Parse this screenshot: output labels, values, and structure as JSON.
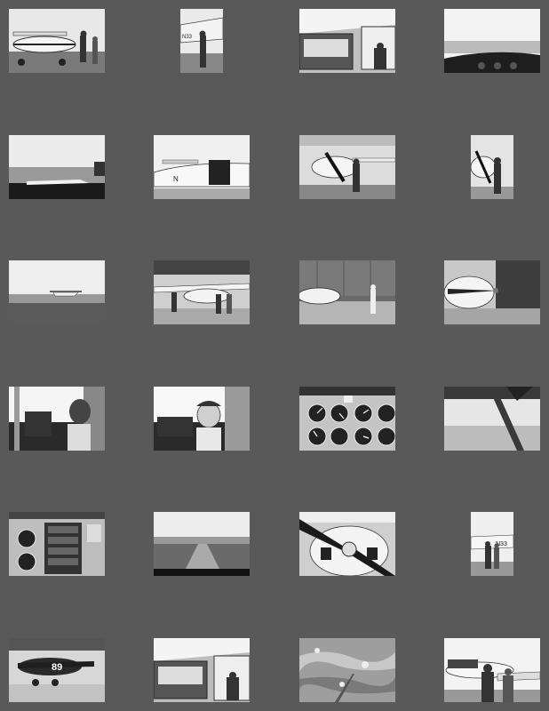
{
  "background_color": "#595959",
  "gallery": {
    "rows": [
      {
        "items": [
          {
            "subject": "plane-and-people-on-tarmac",
            "orientation": "landscape"
          },
          {
            "subject": "person-by-plane-tail",
            "orientation": "portrait"
          },
          {
            "subject": "person-at-cockpit-door",
            "orientation": "landscape"
          },
          {
            "subject": "instrument-panel-view-out",
            "orientation": "landscape"
          }
        ]
      },
      {
        "items": [
          {
            "subject": "wing-in-flight-over-water",
            "orientation": "landscape"
          },
          {
            "subject": "plane-side-door-open",
            "orientation": "landscape"
          },
          {
            "subject": "person-by-propeller-at-hangar",
            "orientation": "landscape"
          },
          {
            "subject": "person-at-nose-of-plane",
            "orientation": "portrait"
          }
        ]
      },
      {
        "items": [
          {
            "subject": "plane-on-runway-distance",
            "orientation": "landscape"
          },
          {
            "subject": "people-by-plane-at-hangar",
            "orientation": "landscape"
          },
          {
            "subject": "plane-nose-in-hangar",
            "orientation": "landscape"
          },
          {
            "subject": "propeller-closeup-hangar",
            "orientation": "landscape"
          }
        ]
      },
      {
        "items": [
          {
            "subject": "pilot-in-cockpit",
            "orientation": "landscape"
          },
          {
            "subject": "boy-in-cockpit-seat",
            "orientation": "landscape"
          },
          {
            "subject": "instrument-gauges-panel",
            "orientation": "landscape"
          },
          {
            "subject": "wing-strut-in-flight",
            "orientation": "landscape"
          }
        ]
      },
      {
        "items": [
          {
            "subject": "radio-stack-panel",
            "orientation": "landscape"
          },
          {
            "subject": "runway-approach-view",
            "orientation": "landscape"
          },
          {
            "subject": "propeller-spinner-closeup",
            "orientation": "landscape"
          },
          {
            "subject": "two-people-by-plane",
            "orientation": "portrait"
          }
        ]
      },
      {
        "items": [
          {
            "subject": "warbird-plane-89",
            "orientation": "landscape"
          },
          {
            "subject": "person-at-cockpit-door-2",
            "orientation": "landscape"
          },
          {
            "subject": "aerial-landscape-view",
            "orientation": "landscape"
          },
          {
            "subject": "group-by-plane",
            "orientation": "landscape"
          }
        ]
      }
    ],
    "plane_numbers": {
      "r1c2": "N33",
      "r5c4": "N33",
      "r6c1": "89"
    }
  }
}
